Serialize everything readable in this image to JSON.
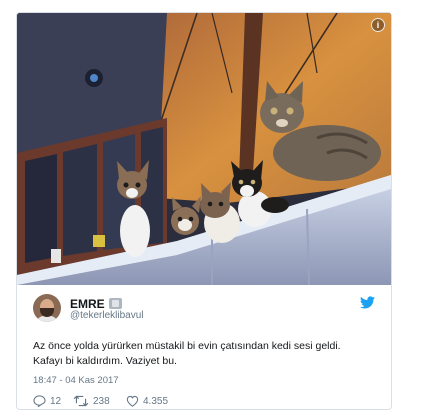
{
  "tweet": {
    "author_name": "EMRE",
    "author_handle": "@tekerleklibavul",
    "text": "Az önce yolda yürürken müstakil bi evin çatısından kedi sesi geldi. Kafayı bi kaldırdım. Vaziyet bu.",
    "timestamp": "18:47 - 04 Kas 2017",
    "replies": "12",
    "retweets": "238",
    "likes": "4.355",
    "info_glyph": "i"
  },
  "icons": {
    "info": "info-icon",
    "brand": "twitter-bird-icon",
    "reply": "reply-icon",
    "retweet": "retweet-icon",
    "like": "heart-icon"
  },
  "colors": {
    "brand_blue": "#1da1f2",
    "text_primary": "#14171a",
    "text_secondary": "#657786",
    "border": "#d9dfe4"
  }
}
